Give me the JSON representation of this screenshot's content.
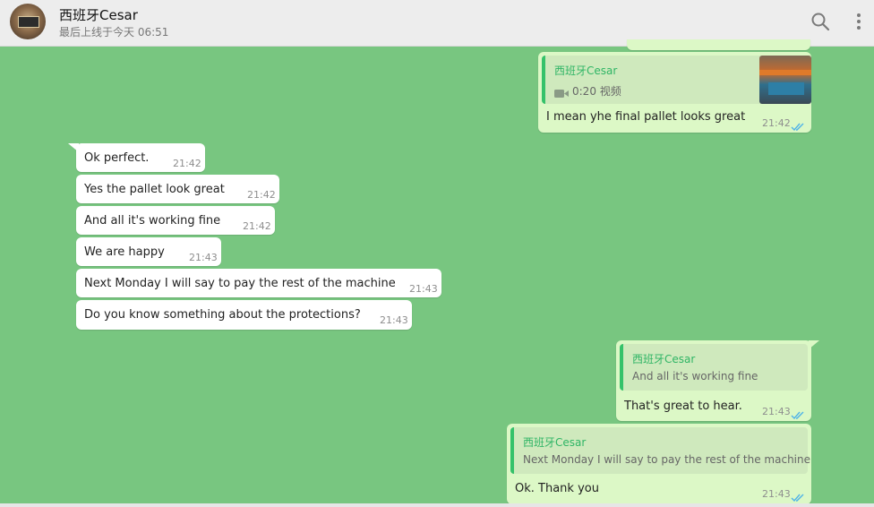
{
  "header": {
    "contact_name": "西班牙Cesar",
    "last_seen": "最后上线于今天 06:51",
    "search_icon": "search-icon",
    "menu_icon": "vertical-dots-icon"
  },
  "colors": {
    "chat_background": "#78c680",
    "incoming_bubble": "#ffffff",
    "outgoing_bubble": "#dcf8c6",
    "quote_accent": "#35c26a",
    "read_ticks": "#4fb3e8"
  },
  "messages": [
    {
      "direction": "out",
      "quote": {
        "author": "西班牙Cesar",
        "media": "0:20 视频",
        "media_icon": "video-camera-icon"
      },
      "text": "I mean yhe final pallet looks great",
      "time": "21:42",
      "status": "read"
    },
    {
      "direction": "in",
      "text": "Ok perfect.",
      "time": "21:42"
    },
    {
      "direction": "in",
      "text": "Yes the pallet look great",
      "time": "21:42"
    },
    {
      "direction": "in",
      "text": "And all it's working fine",
      "time": "21:42"
    },
    {
      "direction": "in",
      "text": "We are happy",
      "time": "21:43"
    },
    {
      "direction": "in",
      "text": "Next Monday I will say to pay the rest of the machine",
      "time": "21:43"
    },
    {
      "direction": "in",
      "text": "Do you know something about the protections?",
      "time": "21:43"
    },
    {
      "direction": "out",
      "quote": {
        "author": "西班牙Cesar",
        "text": "And all it's working fine"
      },
      "text": "That's great to hear.",
      "time": "21:43",
      "status": "read"
    },
    {
      "direction": "out",
      "quote": {
        "author": "西班牙Cesar",
        "text": "Next Monday I will say to pay the rest of the machine"
      },
      "text": "Ok. Thank you",
      "time": "21:43",
      "status": "read"
    }
  ]
}
